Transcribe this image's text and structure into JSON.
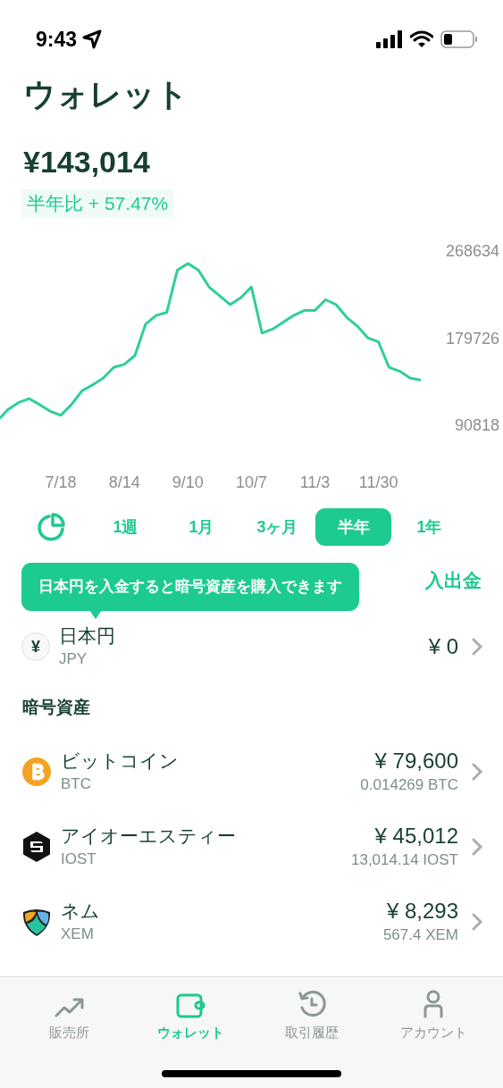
{
  "status_bar": {
    "time": "9:43"
  },
  "title": "ウォレット",
  "balance": "¥143,014",
  "change": "半年比 + 57.47%",
  "chart": {
    "chart_data": {
      "type": "line",
      "categories": [
        null,
        null,
        null,
        null,
        null,
        null,
        "7/18",
        null,
        null,
        null,
        null,
        null,
        "8/14",
        null,
        null,
        null,
        null,
        null,
        "9/10",
        null,
        null,
        null,
        null,
        null,
        "10/7",
        null,
        null,
        null,
        null,
        null,
        "11/3",
        null,
        null,
        null,
        null,
        null,
        "11/30",
        null,
        null,
        null,
        null
      ],
      "series": [
        {
          "color": "#2fcf97",
          "values": [
            97000,
            106000,
            113000,
            117000,
            111000,
            104000,
            100000,
            111000,
            125000,
            131000,
            138000,
            149000,
            152000,
            161000,
            193000,
            202000,
            205000,
            248000,
            255000,
            248000,
            231000,
            222000,
            213000,
            220000,
            231000,
            184000,
            188000,
            195000,
            202000,
            207000,
            207000,
            218000,
            213000,
            200000,
            191000,
            179000,
            175000,
            149000,
            145000,
            138000,
            136000
          ]
        }
      ],
      "ylim": [
        90818,
        268634
      ],
      "yticks": [
        268634,
        179726,
        90818
      ]
    }
  },
  "periods": [
    {
      "label": "1週",
      "selected": false
    },
    {
      "label": "1月",
      "selected": false
    },
    {
      "label": "3ヶ月",
      "selected": false
    },
    {
      "label": "半年",
      "selected": true
    },
    {
      "label": "1年",
      "selected": false
    }
  ],
  "tooltip": "日本円を入金すると暗号資産を購入できます",
  "deposit_button": "入出金",
  "jpy": {
    "icon_text": "¥",
    "name": "日本円",
    "code": "JPY",
    "value": "¥ 0"
  },
  "section_title": "暗号資産",
  "assets": [
    {
      "kind": "btc",
      "name": "ビットコイン",
      "code": "BTC",
      "value": "¥ 79,600",
      "amount": "0.014269 BTC"
    },
    {
      "kind": "iost",
      "name": "アイオーエスティー",
      "code": "IOST",
      "value": "¥ 45,012",
      "amount": "13,014.14 IOST"
    },
    {
      "kind": "xem",
      "name": "ネム",
      "code": "XEM",
      "value": "¥ 8,293",
      "amount": "567.4 XEM"
    }
  ],
  "tabs": [
    {
      "kind": "trend",
      "label": "販売所",
      "selected": false
    },
    {
      "kind": "wallet",
      "label": "ウォレット",
      "selected": true
    },
    {
      "kind": "history",
      "label": "取引履歴",
      "selected": false
    },
    {
      "kind": "account",
      "label": "アカウント",
      "selected": false
    }
  ]
}
